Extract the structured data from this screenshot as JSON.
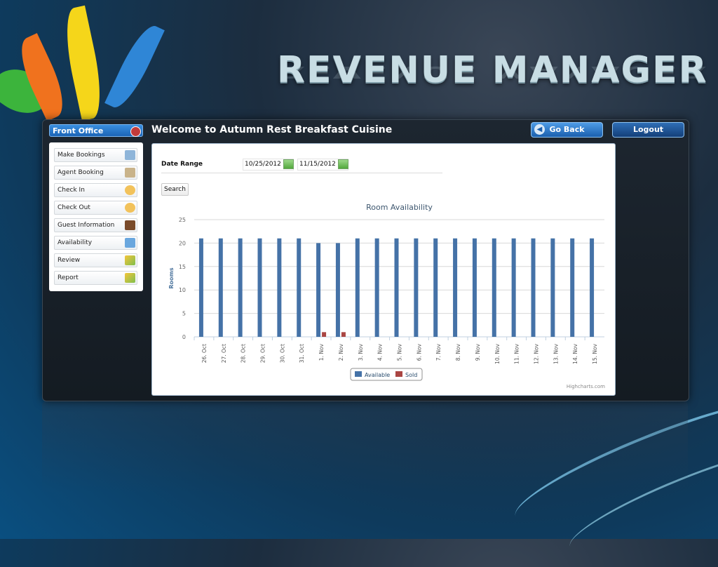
{
  "slide": {
    "title": "REVENUE MANAGER"
  },
  "header": {
    "front_office": "Front Office",
    "welcome": "Welcome to Autumn Rest Breakfast Cuisine",
    "go_back": "Go Back",
    "logout": "Logout"
  },
  "menu": {
    "items": [
      {
        "label": "Make Bookings",
        "icon": "booking-icon",
        "color": "#8fb5d9"
      },
      {
        "label": "Agent Booking",
        "icon": "agent-icon",
        "color": "#c9b38a"
      },
      {
        "label": "Check In",
        "icon": "person-icon",
        "color": "#f2c25b"
      },
      {
        "label": "Check Out",
        "icon": "person-icon",
        "color": "#f2c25b"
      },
      {
        "label": "Guest Information",
        "icon": "book-icon",
        "color": "#7a4b2a"
      },
      {
        "label": "Availability",
        "icon": "availability-icon",
        "color": "#6aa7de"
      },
      {
        "label": "Review",
        "icon": "review-icon",
        "color": "#7fbf4d"
      },
      {
        "label": "Report",
        "icon": "report-icon",
        "color": "#7fbf4d"
      }
    ]
  },
  "form": {
    "date_range_label": "Date Range",
    "from_date": "10/25/2012",
    "to_date": "11/15/2012",
    "search_label": "Search"
  },
  "credit": "Highcharts.com",
  "chart_data": {
    "type": "bar",
    "title": "Room Availability",
    "xlabel": "",
    "ylabel": "Rooms",
    "ylim": [
      0,
      25
    ],
    "yticks": [
      0,
      5,
      10,
      15,
      20,
      25
    ],
    "grid": true,
    "legend_position": "bottom-center",
    "categories": [
      "26. Oct",
      "27. Oct",
      "28. Oct",
      "29. Oct",
      "30. Oct",
      "31. Oct",
      "1. Nov",
      "2. Nov",
      "3. Nov",
      "4. Nov",
      "5. Nov",
      "6. Nov",
      "7. Nov",
      "8. Nov",
      "9. Nov",
      "10. Nov",
      "11. Nov",
      "12. Nov",
      "13. Nov",
      "14. Nov",
      "15. Nov"
    ],
    "series": [
      {
        "name": "Available",
        "color": "#4572a7",
        "values": [
          21,
          21,
          21,
          21,
          21,
          21,
          20,
          20,
          21,
          21,
          21,
          21,
          21,
          21,
          21,
          21,
          21,
          21,
          21,
          21,
          21
        ]
      },
      {
        "name": "Sold",
        "color": "#aa4643",
        "values": [
          0,
          0,
          0,
          0,
          0,
          0,
          1,
          1,
          0,
          0,
          0,
          0,
          0,
          0,
          0,
          0,
          0,
          0,
          0,
          0,
          0
        ]
      }
    ]
  }
}
